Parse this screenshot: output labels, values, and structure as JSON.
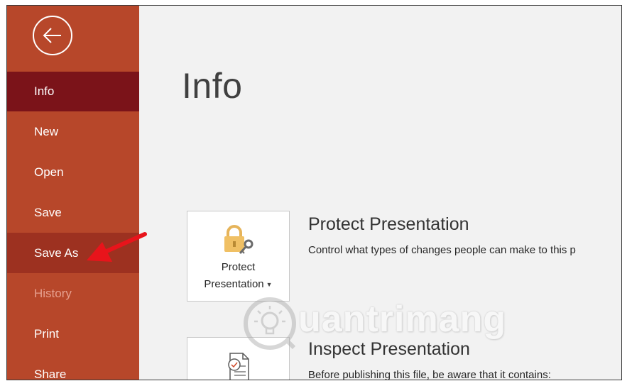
{
  "nav": {
    "items": [
      {
        "label": "Info",
        "state": "active"
      },
      {
        "label": "New",
        "state": "normal"
      },
      {
        "label": "Open",
        "state": "normal"
      },
      {
        "label": "Save",
        "state": "normal"
      },
      {
        "label": "Save As",
        "state": "highlighted"
      },
      {
        "label": "History",
        "state": "disabled"
      },
      {
        "label": "Print",
        "state": "normal"
      },
      {
        "label": "Share",
        "state": "normal"
      }
    ]
  },
  "main": {
    "title": "Info",
    "sections": [
      {
        "title": "Protect Presentation",
        "description": "Control what types of changes people can make to this p",
        "tile_label_line1": "Protect",
        "tile_label_line2": "Presentation",
        "tile_icon": "lock-key-icon"
      },
      {
        "title": "Inspect Presentation",
        "description": "Before publishing this file, be aware that it contains:",
        "tile_icon": "inspect-document-icon"
      }
    ]
  },
  "watermark": {
    "text": "uantrimang",
    "icon": "lightbulb-icon"
  },
  "annotation": {
    "icon": "red-arrow-icon"
  },
  "colors": {
    "sidebar": "#b7472a",
    "nav_active": "#7b1319",
    "nav_highlight": "#9d3120",
    "main_bg": "#f2f2f2",
    "arrow": "#e8141b"
  }
}
